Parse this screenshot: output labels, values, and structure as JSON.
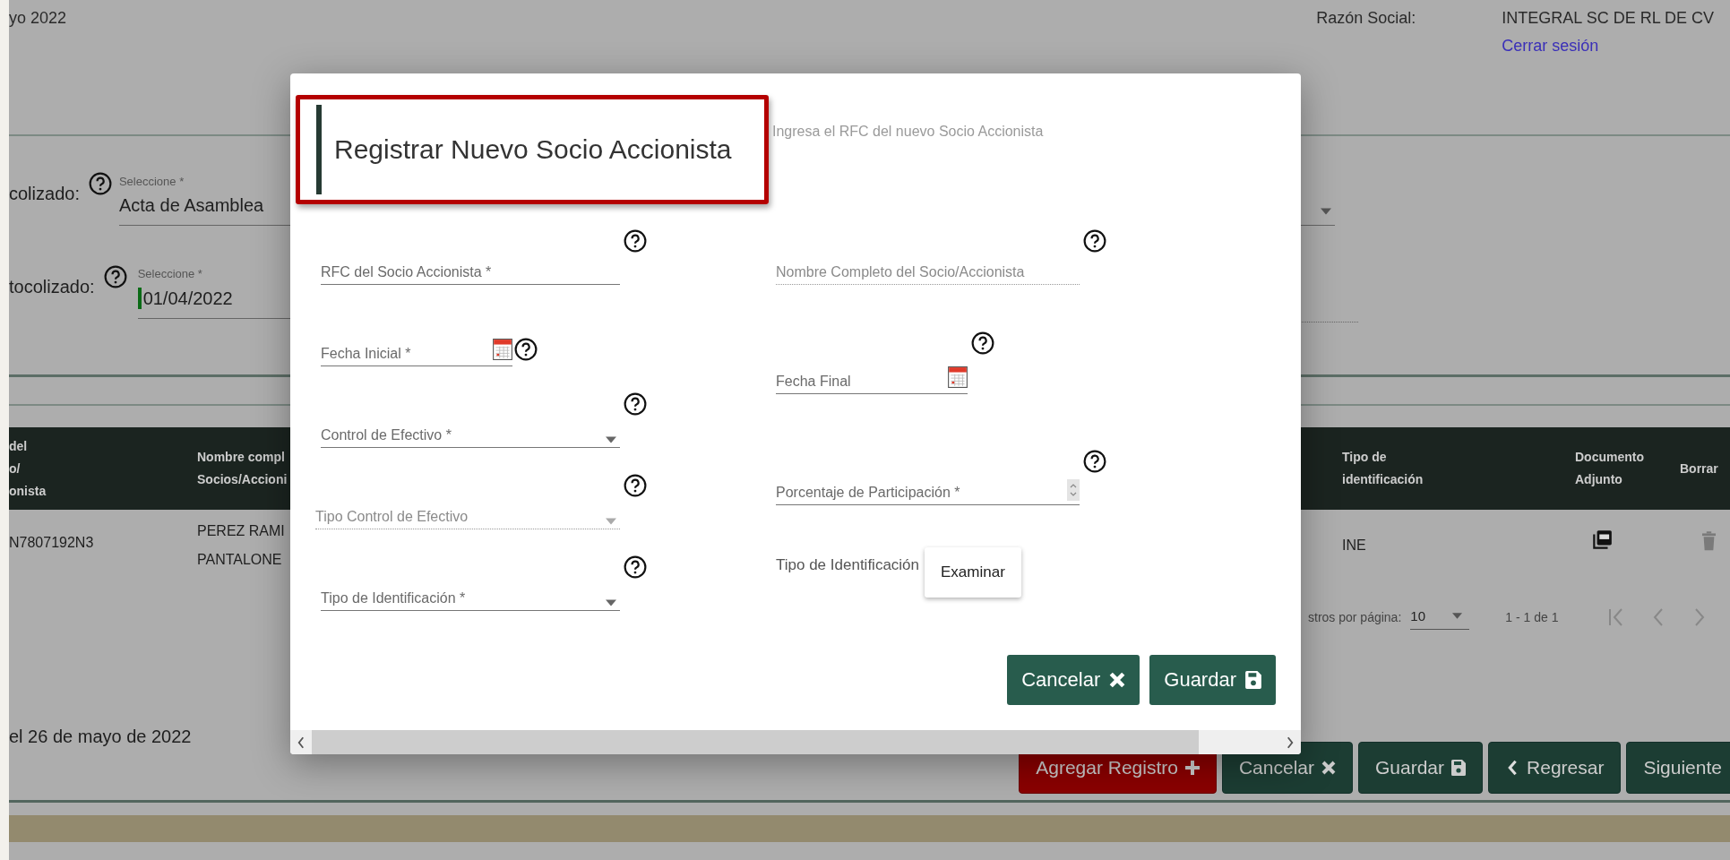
{
  "header": {
    "date_fragment": "yo 2022",
    "company_label": "Razón Social:",
    "company_name": "INTEGRAL SC DE RL DE CV",
    "logout_link": "Cerrar sesión"
  },
  "background_form": [
    {
      "label": "colizado:",
      "hint": "Seleccione *",
      "value": "Acta de Asamblea",
      "focused": false
    },
    {
      "label": "tocolizado:",
      "hint": "Seleccione *",
      "value": "01/04/2022",
      "focused": true
    }
  ],
  "table": {
    "columns": [
      {
        "lines": [
          "del",
          "o/",
          "onista"
        ],
        "kind": "text"
      },
      {
        "lines": [
          "Nombre compl",
          "Socios/Accioni"
        ],
        "kind": "text"
      },
      {
        "lines": [
          "Tipo de",
          "identificación"
        ],
        "kind": "text"
      },
      {
        "lines": [
          "Documento",
          "Adjunto"
        ],
        "kind": "pdf"
      },
      {
        "lines": [
          "Borrar"
        ],
        "kind": "delete"
      }
    ],
    "rows": [
      {
        "cells": [
          [
            "N7807192N3"
          ],
          [
            "PEREZ RAMI",
            "PANTALONE"
          ],
          [
            "INE"
          ],
          [],
          []
        ]
      }
    ]
  },
  "pagination": {
    "per_page_label": "stros por página:",
    "per_page": "10",
    "range": "1 - 1 de 1"
  },
  "footer_note": "el 26 de mayo de 2022",
  "actions": [
    {
      "label": "Agregar Registro",
      "kind": "add"
    },
    {
      "label": "Cancelar",
      "kind": "cancel"
    },
    {
      "label": "Guardar",
      "kind": "save"
    },
    {
      "label": "Regresar",
      "kind": "back"
    },
    {
      "label": "Siguiente",
      "kind": "next"
    }
  ],
  "modal": {
    "title": "Registrar Nuevo Socio Accionista",
    "subtitle": "Ingresa el RFC del nuevo Socio Accionista",
    "left_fields": [
      {
        "placeholder": "RFC del Socio Accionista *",
        "kind": "text",
        "disabled": false
      },
      {
        "placeholder": "Fecha Inicial *",
        "kind": "date",
        "disabled": false
      },
      {
        "placeholder": "Control de Efectivo *",
        "kind": "select",
        "disabled": false
      },
      {
        "placeholder": "Tipo Control de Efectivo",
        "kind": "select",
        "disabled": true
      },
      {
        "placeholder": "Tipo de Identificación *",
        "kind": "select",
        "disabled": false
      }
    ],
    "right_fields": [
      {
        "placeholder": "Nombre Completo del Socio/Accionista",
        "kind": "text",
        "disabled": true
      },
      {
        "placeholder": "Fecha Final",
        "kind": "date",
        "disabled": false
      },
      {
        "placeholder": "Porcentaje de Participación *",
        "kind": "number",
        "disabled": false
      },
      {
        "label": "Tipo de Identificación",
        "kind": "file",
        "button": "Examinar"
      }
    ],
    "buttons": [
      {
        "label": "Cancelar",
        "kind": "cancel"
      },
      {
        "label": "Guardar",
        "kind": "save"
      }
    ]
  }
}
